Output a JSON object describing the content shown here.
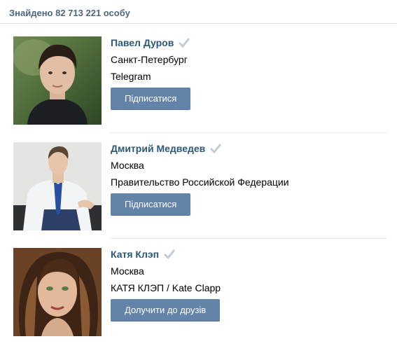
{
  "header": {
    "found_text": "Знайдено 82 713 221 особу"
  },
  "people": [
    {
      "name": "Павел Дуров",
      "city": "Санкт-Петербург",
      "info": "Telegram",
      "button": "Підписатися"
    },
    {
      "name": "Дмитрий Медведев",
      "city": "Москва",
      "info": "Правительство Российской Федерации",
      "button": "Підписатися"
    },
    {
      "name": "Катя Клэп",
      "city": "Москва",
      "info": "КАТЯ КЛЭП / Kate Clapp",
      "button": "Долучити до друзів"
    }
  ],
  "colors": {
    "header_text": "#4d6580",
    "name_link": "#2b587a",
    "button_bg": "#6383a8",
    "verified_check": "#c5ccd3"
  },
  "icons": {
    "verified": "verified-check-icon"
  }
}
